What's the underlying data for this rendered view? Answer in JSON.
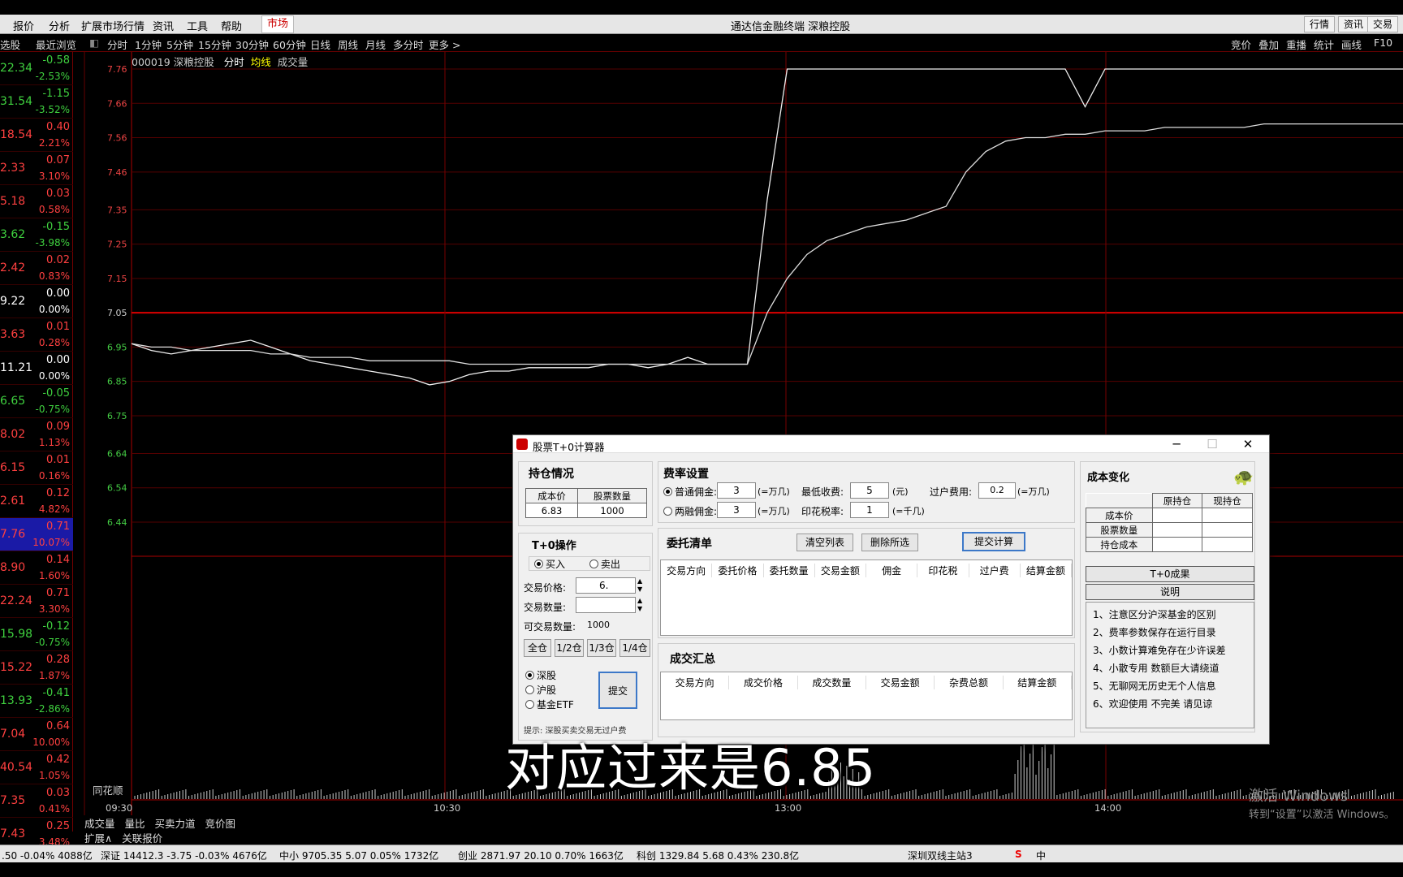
{
  "menu": [
    "报价",
    "分析",
    "扩展市场行情",
    "资讯",
    "工具",
    "帮助"
  ],
  "market_label": "市场",
  "window_title": "通达信金融终端  深粮控股",
  "right_buttons": [
    "行情",
    "资讯",
    "交易"
  ],
  "left_header": [
    "选股",
    "最近浏览"
  ],
  "periods": [
    "分时",
    "1分钟",
    "5分钟",
    "15分钟",
    "30分钟",
    "60分钟",
    "日线",
    "周线",
    "月线",
    "多分时",
    "更多 >"
  ],
  "right_tools": [
    "竞价",
    "叠加",
    "重播",
    "统计",
    "画线",
    "F10"
  ],
  "chart_info": {
    "code_name": "000019 深粮控股",
    "fen_shi": "分时",
    "jun_xian": "均线",
    "cheng_jiao": "成交量"
  },
  "watchlist": [
    {
      "p": "22.34",
      "c": "-0.58",
      "pct": "-2.53%",
      "color": "#3fd13f"
    },
    {
      "p": "31.54",
      "c": "-1.15",
      "pct": "-3.52%",
      "color": "#3fd13f"
    },
    {
      "p": "18.54",
      "c": "0.40",
      "pct": "2.21%",
      "color": "#ff4040"
    },
    {
      "p": "2.33",
      "c": "0.07",
      "pct": "3.10%",
      "color": "#ff4040"
    },
    {
      "p": "5.18",
      "c": "0.03",
      "pct": "0.58%",
      "color": "#ff4040"
    },
    {
      "p": "3.62",
      "c": "-0.15",
      "pct": "-3.98%",
      "color": "#3fd13f"
    },
    {
      "p": "2.42",
      "c": "0.02",
      "pct": "0.83%",
      "color": "#ff4040"
    },
    {
      "p": "9.22",
      "c": "0.00",
      "pct": "0.00%",
      "color": "#ffffff"
    },
    {
      "p": "3.63",
      "c": "0.01",
      "pct": "0.28%",
      "color": "#ff4040"
    },
    {
      "p": "11.21",
      "c": "0.00",
      "pct": "0.00%",
      "color": "#ffffff"
    },
    {
      "p": "6.65",
      "c": "-0.05",
      "pct": "-0.75%",
      "color": "#3fd13f"
    },
    {
      "p": "8.02",
      "c": "0.09",
      "pct": "1.13%",
      "color": "#ff4040"
    },
    {
      "p": "6.15",
      "c": "0.01",
      "pct": "0.16%",
      "color": "#ff4040"
    },
    {
      "p": "2.61",
      "c": "0.12",
      "pct": "4.82%",
      "color": "#ff4040"
    },
    {
      "p": "7.76",
      "c": "0.71",
      "pct": "10.07%",
      "color": "#ff4040",
      "selected": true
    },
    {
      "p": "8.90",
      "c": "0.14",
      "pct": "1.60%",
      "color": "#ff4040"
    },
    {
      "p": "22.24",
      "c": "0.71",
      "pct": "3.30%",
      "color": "#ff4040"
    },
    {
      "p": "15.98",
      "c": "-0.12",
      "pct": "-0.75%",
      "color": "#3fd13f"
    },
    {
      "p": "15.22",
      "c": "0.28",
      "pct": "1.87%",
      "color": "#ff4040"
    },
    {
      "p": "13.93",
      "c": "-0.41",
      "pct": "-2.86%",
      "color": "#3fd13f"
    },
    {
      "p": "7.04",
      "c": "0.64",
      "pct": "10.00%",
      "color": "#ff4040"
    },
    {
      "p": "40.54",
      "c": "0.42",
      "pct": "1.05%",
      "color": "#ff4040"
    },
    {
      "p": "7.35",
      "c": "0.03",
      "pct": "0.41%",
      "color": "#ff4040"
    },
    {
      "p": "7.43",
      "c": "0.25",
      "pct": "3.48%",
      "color": "#ff4040"
    }
  ],
  "chart_data": {
    "type": "line",
    "y_ticks": [
      "7.76",
      "7.66",
      "7.56",
      "7.46",
      "7.35",
      "7.25",
      "7.15",
      "7.05",
      "6.95",
      "6.85",
      "6.75",
      "6.64",
      "6.54",
      "6.44"
    ],
    "x_ticks": [
      "09:30",
      "10:30",
      "13:00",
      "14:00"
    ],
    "ylim": [
      6.44,
      7.76
    ],
    "prev_close": 7.05,
    "series": [
      {
        "values": [
          6.96,
          6.94,
          6.93,
          6.94,
          6.95,
          6.96,
          6.97,
          6.95,
          6.93,
          6.91,
          6.9,
          6.89,
          6.88,
          6.87,
          6.86,
          6.84,
          6.85,
          6.87,
          6.88,
          6.88,
          6.89,
          6.89,
          6.89,
          6.89,
          6.9,
          6.9,
          6.89,
          6.9,
          6.92,
          6.9,
          6.9,
          6.9,
          7.38,
          7.76,
          7.76,
          7.76,
          7.76,
          7.76,
          7.76,
          7.76,
          7.76,
          7.76,
          7.76,
          7.76,
          7.76,
          7.76,
          7.76,
          7.76,
          7.65,
          7.76,
          7.76,
          7.76,
          7.76,
          7.76,
          7.76,
          7.76,
          7.76,
          7.76,
          7.76,
          7.76,
          7.76,
          7.76,
          7.76,
          7.76,
          7.76
        ]
      },
      {
        "values": [
          6.96,
          6.95,
          6.95,
          6.94,
          6.94,
          6.94,
          6.94,
          6.93,
          6.93,
          6.92,
          6.92,
          6.92,
          6.91,
          6.91,
          6.91,
          6.91,
          6.91,
          6.9,
          6.9,
          6.9,
          6.9,
          6.9,
          6.9,
          6.9,
          6.9,
          6.9,
          6.9,
          6.9,
          6.9,
          6.9,
          6.9,
          6.9,
          7.05,
          7.15,
          7.22,
          7.26,
          7.28,
          7.3,
          7.31,
          7.32,
          7.34,
          7.36,
          7.46,
          7.52,
          7.55,
          7.56,
          7.56,
          7.57,
          7.57,
          7.58,
          7.58,
          7.58,
          7.59,
          7.59,
          7.59,
          7.59,
          7.59,
          7.6,
          7.6,
          7.6,
          7.6,
          7.6,
          7.6,
          7.6,
          7.6
        ]
      }
    ]
  },
  "tonghuashun": "同花顺",
  "bottom_tabs": [
    "成交量",
    "量比",
    "买卖力道",
    "竞价图"
  ],
  "bottom_tabs2": [
    "扩展∧",
    "关联报价"
  ],
  "status": [
    {
      "t": ".50  -0.04%  4088亿",
      "c": "#000"
    },
    {
      "t": "深证 14412.3  -3.75  -0.03%  4676亿",
      "c": "#000"
    },
    {
      "t": "中小 9705.35  5.07  0.05%  1732亿",
      "c": "#000"
    },
    {
      "t": "创业 2871.97  20.10  0.70%  1663亿",
      "c": "#000"
    },
    {
      "t": "科创 1329.84  5.68  0.43%  230.8亿",
      "c": "#000"
    },
    {
      "t": "深圳双线主站3",
      "c": "#000"
    }
  ],
  "dialog": {
    "title": "股票T+0计算器",
    "holding": {
      "title": "持仓情况",
      "h1": "成本价",
      "h2": "股票数量",
      "v1": "6.83",
      "v2": "1000"
    },
    "t0": {
      "title": "T+0操作",
      "buy": "买入",
      "sell": "卖出",
      "price_label": "交易价格:",
      "price_value": "6.",
      "qty_label": "交易数量:",
      "avail_label": "可交易数量:",
      "avail_value": "1000",
      "fractions": [
        "全仓",
        "1/2仓",
        "1/3仓",
        "1/4仓"
      ],
      "exchanges": [
        "深股",
        "沪股",
        "基金ETF"
      ],
      "submit": "提交",
      "hint": "提示: 深股买卖交易无过户费"
    },
    "fees": {
      "title": "费率设置",
      "normal": "普通佣金:",
      "normal_v": "3",
      "unit_wanji": "(=万几)",
      "min_label": "最低收费:",
      "min_v": "5",
      "yuan": "(元)",
      "transfer_label": "过户费用:",
      "transfer_v": "0.2",
      "margin": "两融佣金:",
      "margin_v": "3",
      "stamp_label": "印花税率:",
      "stamp_v": "1",
      "unit_qianji": "(=千几)"
    },
    "orders": {
      "title": "委托清单",
      "clear": "清空列表",
      "delete": "删除所选",
      "calc": "提交计算",
      "cols": [
        "交易方向",
        "委托价格",
        "委托数量",
        "交易金额",
        "佣金",
        "印花税",
        "过户费",
        "结算金额"
      ]
    },
    "summary": {
      "title": "成交汇总",
      "cols": [
        "交易方向",
        "成交价格",
        "成交数量",
        "交易金额",
        "杂费总额",
        "结算金额"
      ]
    },
    "cost": {
      "title": "成本变化",
      "cols": [
        "原持仓",
        "现持仓"
      ],
      "rows": [
        "成本价",
        "股票数量",
        "持仓成本"
      ],
      "t0_result": "T+0成果",
      "explain": "说明",
      "notes": [
        "1、注意区分沪深基金的区别",
        "2、费率参数保存在运行目录",
        "3、小数计算难免存在少许误差",
        "4、小散专用 数额巨大请绕道",
        "5、无聊网无历史无个人信息",
        "6、欢迎使用 不完美 请见谅"
      ]
    }
  },
  "subtitle": "对应过来是6.85",
  "watermark": [
    "激活 Windows",
    "转到“设置”以激活 Windows。"
  ]
}
